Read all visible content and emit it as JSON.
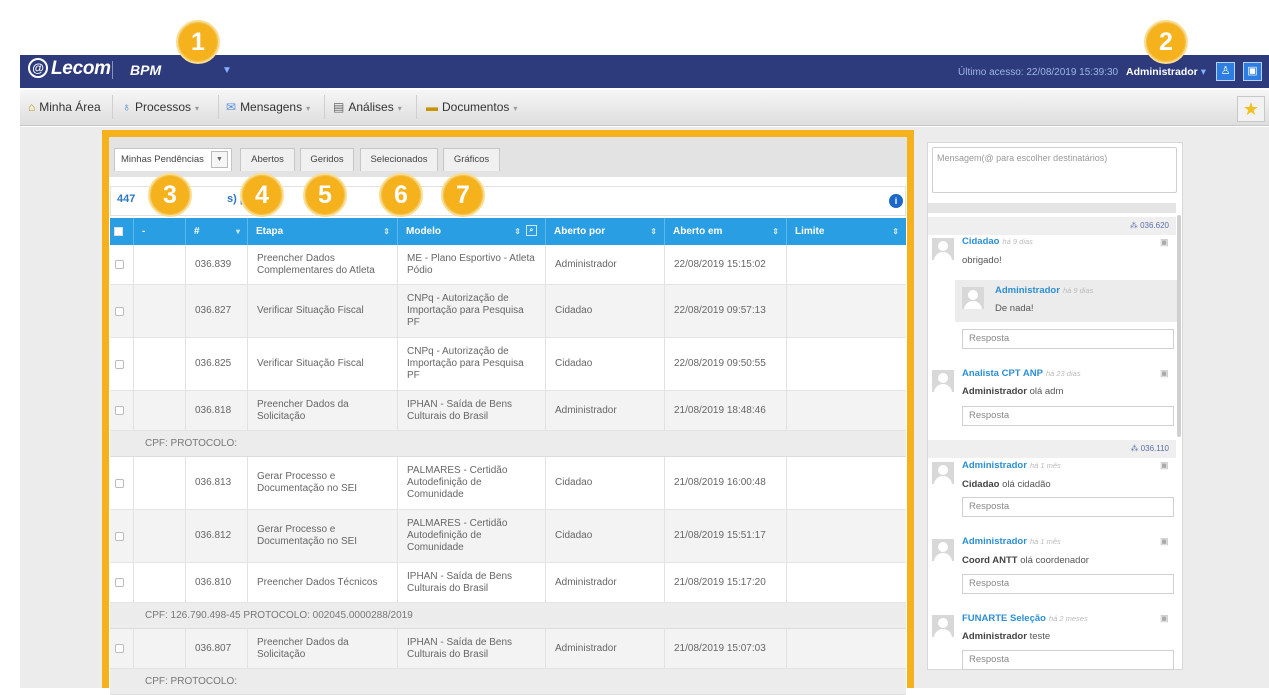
{
  "header": {
    "logo": "Lecom",
    "app": "BPM",
    "last_access": "Último acesso: 22/08/2019 15:39:30",
    "user": "Administrador"
  },
  "menu": [
    {
      "label": "Minha Área"
    },
    {
      "label": "Processos"
    },
    {
      "label": "Mensagens"
    },
    {
      "label": "Análises"
    },
    {
      "label": "Documentos"
    }
  ],
  "tabs": [
    "Minhas Pendências",
    "Abertos",
    "Geridos",
    "Selecionados",
    "Gráficos"
  ],
  "count": {
    "p1": "447",
    "p2": "s) pend",
    "p3": ")"
  },
  "table": {
    "columns": [
      "-",
      "#",
      "Etapa",
      "Modelo",
      "Aberto por",
      "Aberto em",
      "Limite"
    ],
    "rows": [
      {
        "id": "036.839",
        "etapa": "Preencher Dados Complementares do Atleta",
        "modelo": "ME - Plano Esportivo - Atleta Pódio",
        "por": "Administrador",
        "em": "22/08/2019 15:15:02"
      },
      {
        "id": "036.827",
        "etapa": "Verificar Situação Fiscal",
        "modelo": "CNPq - Autorização de Importação para Pesquisa PF",
        "por": "Cidadao",
        "em": "22/08/2019 09:57:13"
      },
      {
        "id": "036.825",
        "etapa": "Verificar Situação Fiscal",
        "modelo": "CNPq - Autorização de Importação para Pesquisa PF",
        "por": "Cidadao",
        "em": "22/08/2019 09:50:55"
      },
      {
        "id": "036.818",
        "etapa": "Preencher Dados da Solicitação",
        "modelo": "IPHAN - Saída de Bens Culturais do Brasil",
        "por": "Administrador",
        "em": "21/08/2019 18:48:46"
      },
      {
        "cpf": "CPF:   PROTOCOLO:"
      },
      {
        "id": "036.813",
        "etapa": "Gerar Processo e Documentação no SEI",
        "modelo": "PALMARES - Certidão Autodefinição de Comunidade",
        "por": "Cidadao",
        "em": "21/08/2019 16:00:48"
      },
      {
        "id": "036.812",
        "etapa": "Gerar Processo e Documentação no SEI",
        "modelo": "PALMARES - Certidão Autodefinição de Comunidade",
        "por": "Cidadao",
        "em": "21/08/2019 15:51:17"
      },
      {
        "id": "036.810",
        "etapa": "Preencher Dados Técnicos",
        "modelo": "IPHAN - Saída de Bens Culturais do Brasil",
        "por": "Administrador",
        "em": "21/08/2019 15:17:20"
      },
      {
        "cpf": "CPF: 126.790.498-45   PROTOCOLO: 002045.0000288/2019"
      },
      {
        "id": "036.807",
        "etapa": "Preencher Dados da Solicitação",
        "modelo": "IPHAN - Saída de Bens Culturais do Brasil",
        "por": "Administrador",
        "em": "21/08/2019 15:07:03"
      },
      {
        "cpf": "CPF:   PROTOCOLO:"
      }
    ]
  },
  "badges": [
    "1",
    "2",
    "3",
    "4",
    "5",
    "6",
    "7"
  ],
  "chat": {
    "placeholder": "Mensagem(@ para escolher destinatários)",
    "threads": [
      {
        "id": "036.620"
      },
      {
        "id": "036.110"
      }
    ],
    "comments": [
      {
        "author": "Cidadao",
        "time": "há 9 dias",
        "text": "obrigado!"
      },
      {
        "author": "Administrador",
        "time": "há 9 dias",
        "text": "De nada!"
      },
      {
        "author": "Analista CPT ANP",
        "time": "há 23 dias",
        "mention": "Administrador",
        "text": " olá adm"
      },
      {
        "author": "Administrador",
        "time": "há 1 mês",
        "mention": "Cidadao",
        "text": " olá cidadão"
      },
      {
        "author": "Administrador",
        "time": "há 1 mês",
        "mention": "Coord ANTT",
        "text": " olá coordenador"
      },
      {
        "author": "FUNARTE Seleção",
        "time": "há 2 meses",
        "mention": "Administrador",
        "text": " teste"
      }
    ],
    "reply": "Resposta"
  },
  "colors": {
    "accent": "#f5b21c",
    "topbar": "#2d3a7c",
    "table_header": "#2a9ee2"
  }
}
